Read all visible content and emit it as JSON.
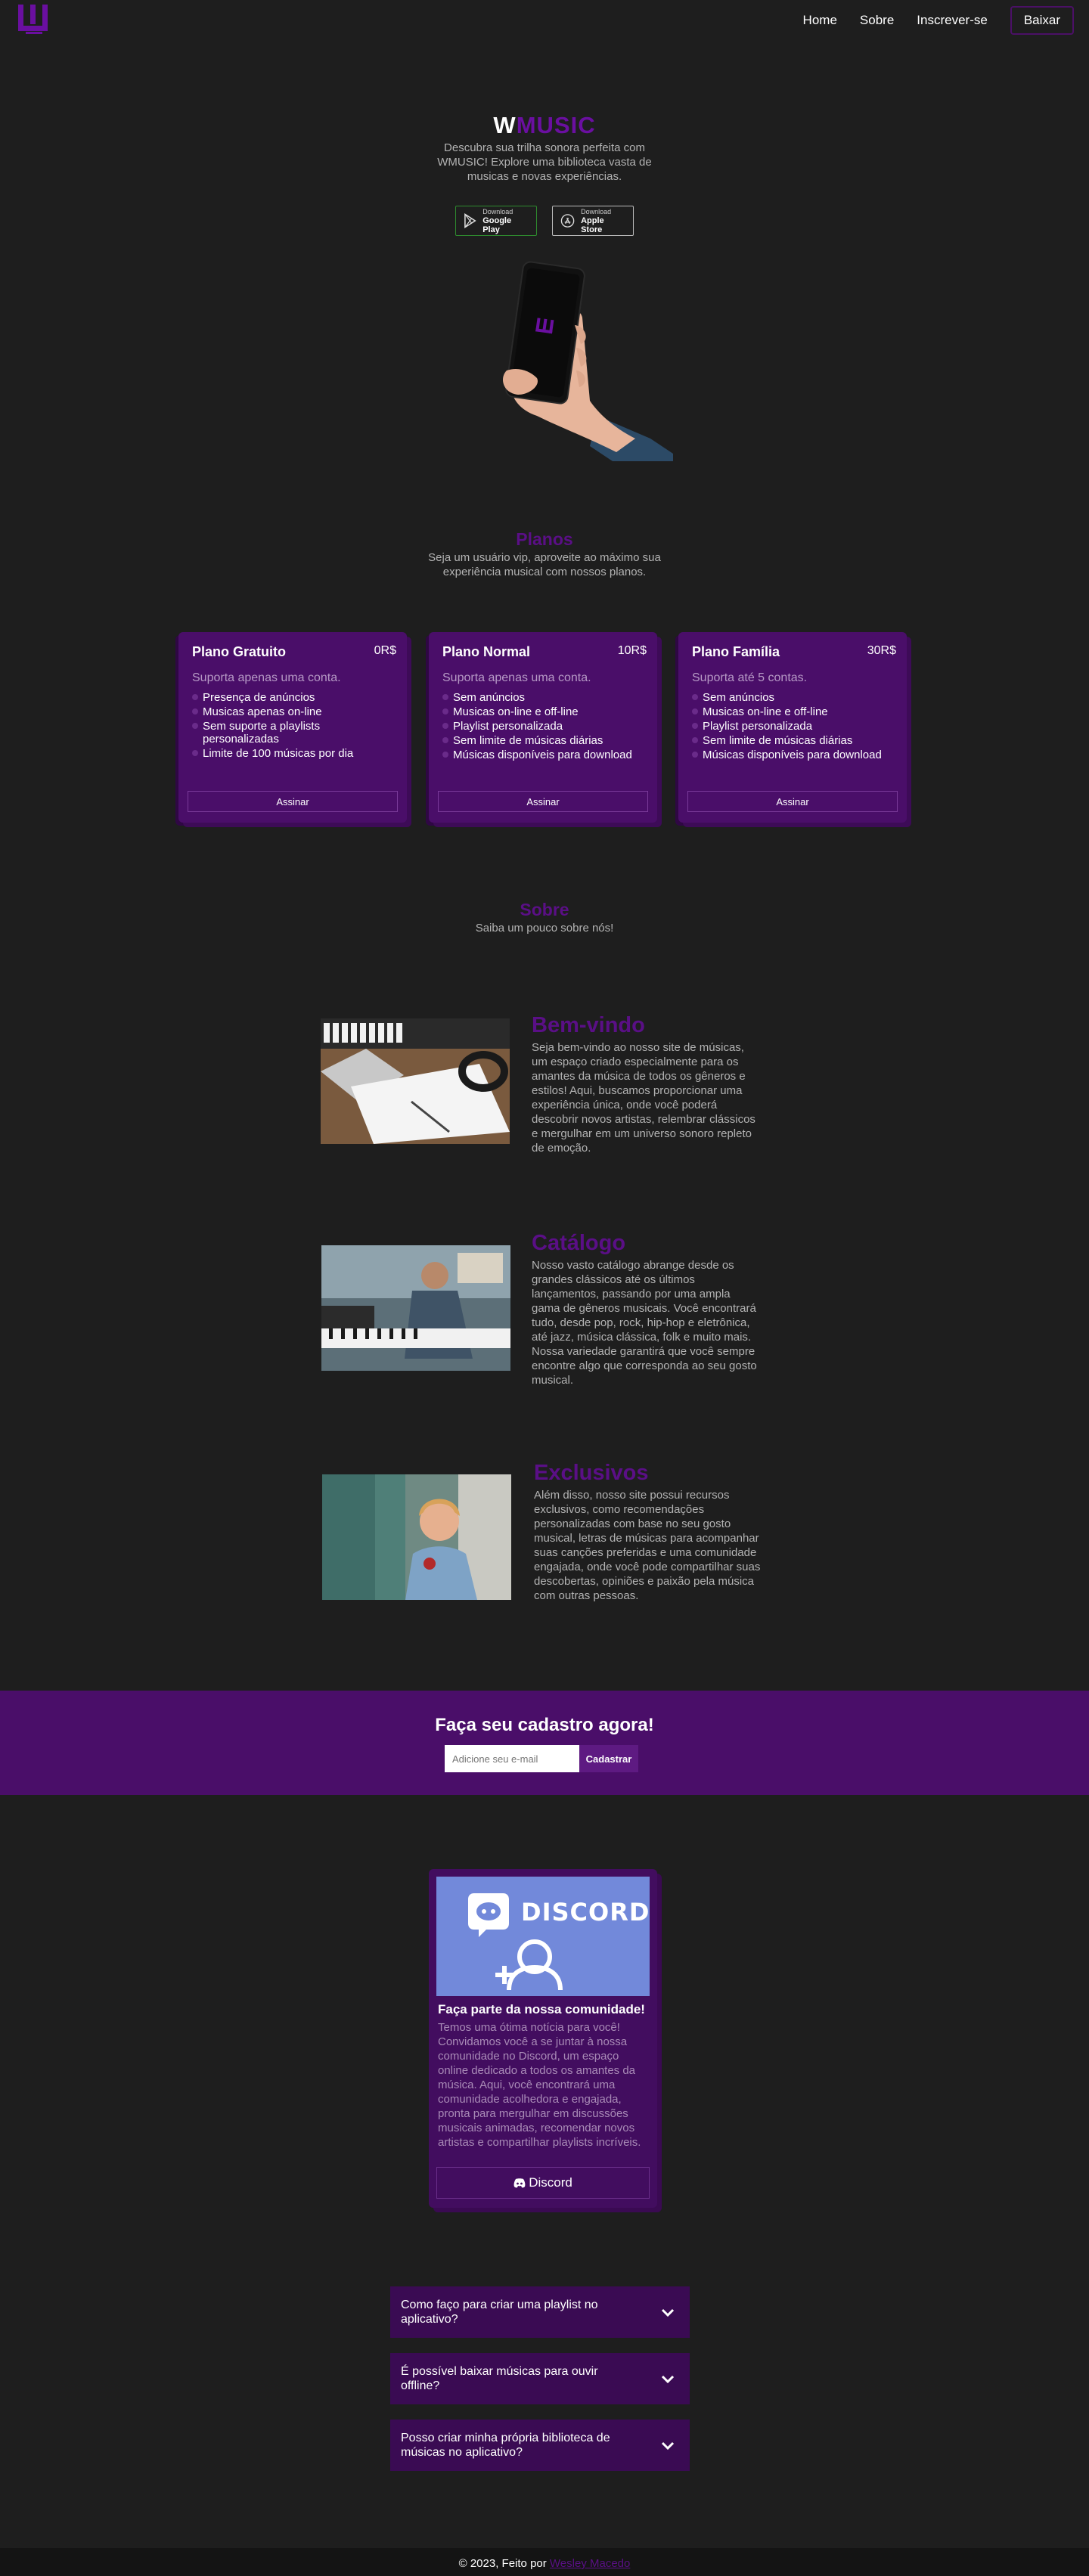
{
  "nav": {
    "links": [
      "Home",
      "Sobre",
      "Inscrever-se"
    ],
    "cta": "Baixar"
  },
  "hero": {
    "title_w": "W",
    "title_rest": "MUSIC",
    "subtitle": "Descubra sua trilha sonora perfeita com WMUSIC! Explore uma biblioteca vasta de musicas e novas experiências.",
    "google": {
      "small": "Download",
      "big": "Google Play"
    },
    "apple": {
      "small": "Download",
      "big": "Apple Store"
    }
  },
  "plans_section": {
    "title": "Planos",
    "subtitle": "Seja um usuário vip, aproveite ao máximo sua experiência musical com nossos planos."
  },
  "plans": [
    {
      "name": "Plano Gratuito",
      "price": "0R$",
      "support": "Suporta apenas uma conta.",
      "features": [
        "Presença de anúncios",
        "Musicas apenas on-line",
        "Sem suporte a playlists personalizadas",
        "Limite de 100 músicas por dia"
      ],
      "button": "Assinar"
    },
    {
      "name": "Plano Normal",
      "price": "10R$",
      "support": "Suporta apenas uma conta.",
      "features": [
        "Sem anúncios",
        "Musicas on-line e off-line",
        "Playlist personalizada",
        "Sem limite de músicas diárias",
        "Músicas disponíveis para download"
      ],
      "button": "Assinar"
    },
    {
      "name": "Plano Família",
      "price": "30R$",
      "support": "Suporta até 5 contas.",
      "features": [
        "Sem anúncios",
        "Musicas on-line e off-line",
        "Playlist personalizada",
        "Sem limite de músicas diárias",
        "Músicas disponíveis para download"
      ],
      "button": "Assinar"
    }
  ],
  "about_section": {
    "title": "Sobre",
    "subtitle": "Saiba um pouco sobre nós!"
  },
  "about_items": [
    {
      "title": "Bem-vindo",
      "text": "Seja bem-vindo ao nosso site de músicas, um espaço criado especialmente para os amantes da música de todos os gêneros e estilos! Aqui, buscamos proporcionar uma experiência única, onde você poderá descobrir novos artistas, relembrar clássicos e mergulhar em um universo sonoro repleto de emoção."
    },
    {
      "title": "Catálogo",
      "text": "Nosso vasto catálogo abrange desde os grandes clássicos até os últimos lançamentos, passando por uma ampla gama de gêneros musicais. Você encontrará tudo, desde pop, rock, hip-hop e eletrônica, até jazz, música clássica, folk e muito mais. Nossa variedade garantirá que você sempre encontre algo que corresponda ao seu gosto musical."
    },
    {
      "title": "Exclusivos",
      "text": "Além disso, nosso site possui recursos exclusivos, como recomendações personalizadas com base no seu gosto musical, letras de músicas para acompanhar suas canções preferidas e uma comunidade engajada, onde você pode compartilhar suas descobertas, opiniões e paixão pela música com outras pessoas."
    }
  ],
  "signup": {
    "title": "Faça seu cadastro agora!",
    "placeholder": "Adicione seu e-mail",
    "button": "Cadastrar"
  },
  "discord": {
    "banner_word": "DISCORD",
    "title": "Faça parte da nossa comunidade!",
    "text": "Temos uma ótima notícia para você! Convidamos você a se juntar à nossa comunidade no Discord, um espaço online dedicado a todos os amantes da música. Aqui, você encontrará uma comunidade acolhedora e engajada, pronta para mergulhar em discussões musicais animadas, recomendar novos artistas e compartilhar playlists incríveis.",
    "button": "Discord"
  },
  "faq": [
    "Como faço para criar uma playlist no aplicativo?",
    "É possível baixar músicas para ouvir offline?",
    "Posso criar minha própria biblioteca de músicas no aplicativo?"
  ],
  "footer": {
    "text": "© 2023, Feito por ",
    "author": "Wesley Macedo"
  },
  "colors": {
    "background": "#1e1e1e",
    "accent": "#5a0f86",
    "card": "#4a0e69",
    "footer": "#141414"
  }
}
